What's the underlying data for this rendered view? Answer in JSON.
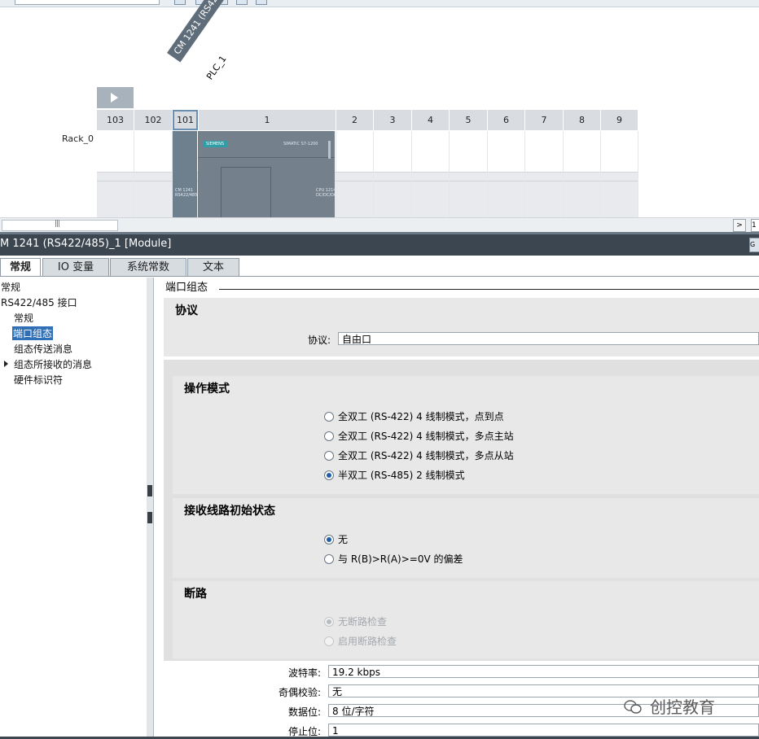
{
  "device_view": {
    "module_tag": "CM 1241 (RS422/4...",
    "plc_tag": "PLC_1",
    "rack_label": "Rack_0",
    "slots": [
      "103",
      "102",
      "101",
      "1",
      "2",
      "3",
      "4",
      "5",
      "6",
      "7",
      "8",
      "9"
    ],
    "selected_slot": "101",
    "cm_module_text": "CM 1241\nRS422/485",
    "cpu_brand": "SIEMENS",
    "cpu_model": "SIMATIC S7-1200",
    "cpu_type_text": "CPU 1214C\nDC/DC/DC",
    "scroll_right_glyph": ">",
    "scroll_extra": "1"
  },
  "inspector": {
    "title": "M 1241 (RS422/485)_1 [Module]",
    "corner_button": "G",
    "tabs": [
      "常规",
      "IO 变量",
      "系统常数",
      "文本"
    ],
    "active_tab": "常规"
  },
  "nav_tree": {
    "items": [
      {
        "label": "常规",
        "indent": 0,
        "selected": false,
        "expandable": false
      },
      {
        "label": "RS422/485 接口",
        "indent": 0,
        "selected": false,
        "expandable": false
      },
      {
        "label": "常规",
        "indent": 1,
        "selected": false,
        "expandable": false
      },
      {
        "label": "端口组态",
        "indent": 1,
        "selected": true,
        "expandable": false
      },
      {
        "label": "组态传送消息",
        "indent": 1,
        "selected": false,
        "expandable": false
      },
      {
        "label": "组态所接收的消息",
        "indent": 1,
        "selected": false,
        "expandable": true
      },
      {
        "label": "硬件标识符",
        "indent": 1,
        "selected": false,
        "expandable": false
      }
    ]
  },
  "content": {
    "section_header": "端口组态",
    "protocol": {
      "title": "协议",
      "label": "协议:",
      "value": "自由口"
    },
    "operating_mode": {
      "title": "操作模式",
      "options": [
        {
          "label": "全双工 (RS-422) 4 线制模式，点到点",
          "checked": false
        },
        {
          "label": "全双工 (RS-422) 4 线制模式，多点主站",
          "checked": false
        },
        {
          "label": "全双工 (RS-422) 4 线制模式，多点从站",
          "checked": false
        },
        {
          "label": "半双工 (RS-485) 2 线制模式",
          "checked": true
        }
      ]
    },
    "receive_line": {
      "title": "接收线路初始状态",
      "options": [
        {
          "label": "无",
          "checked": true
        },
        {
          "label": "与 R(B)>R(A)>=0V 的偏差",
          "checked": false
        }
      ]
    },
    "break_detection": {
      "title": "断路",
      "options": [
        {
          "label": "无断路检查",
          "checked": true,
          "disabled": true
        },
        {
          "label": "启用断路检查",
          "checked": false,
          "disabled": true
        }
      ]
    },
    "params": [
      {
        "label": "波特率:",
        "value": "19.2 kbps"
      },
      {
        "label": "奇偶校验:",
        "value": "无"
      },
      {
        "label": "数据位:",
        "value": "8 位/字符"
      },
      {
        "label": "停止位:",
        "value": "1"
      }
    ]
  },
  "watermark": {
    "text": "创控教育"
  }
}
